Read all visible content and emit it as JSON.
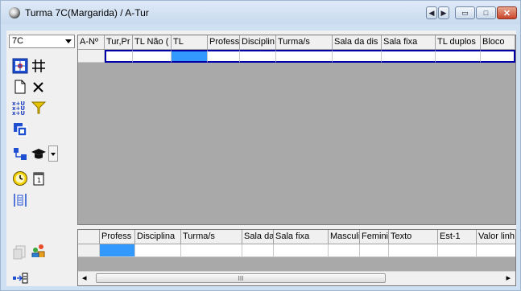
{
  "window": {
    "title": "Turma 7C(Margarida) / A-Tur",
    "nav_prev": "◀",
    "nav_next": "▶",
    "minimize": "▭",
    "maximize": "□",
    "close": "✕"
  },
  "left_panel": {
    "class_select": "7C",
    "icons": [
      "layout-icon",
      "grid-icon",
      "new-document-icon",
      "delete-icon",
      "formula-icon",
      "filter-icon",
      "copy-icon",
      "connect-icon",
      "teacher-hat-icon",
      "dropdown-arrow-icon",
      "clock-icon",
      "calendar-icon",
      "columns-icon",
      "disabled-document-icon",
      "people-icon",
      "arrow-link-icon"
    ]
  },
  "top_grid": {
    "columns": [
      "A-Nº",
      "Tur,Pr",
      "TL Não (",
      "TL",
      "Profess",
      "Disciplin",
      "Turma/s",
      "Sala da dis",
      "Sala fixa",
      "TL duplos",
      "Bloco"
    ]
  },
  "bottom_grid": {
    "columns": [
      "",
      "Profess",
      "Disciplina",
      "Turma/s",
      "Sala da",
      "Sala fixa",
      "Masculi",
      "Feminin",
      "Texto",
      "Est-1",
      "Valor linh"
    ]
  },
  "scroll": {
    "left_arrow": "◂",
    "right_arrow": "▸",
    "thumb_grip": "III"
  },
  "colors": {
    "selection": "#3399ff",
    "grid_background": "#a9a9a9",
    "row_outline": "#0000aa"
  }
}
